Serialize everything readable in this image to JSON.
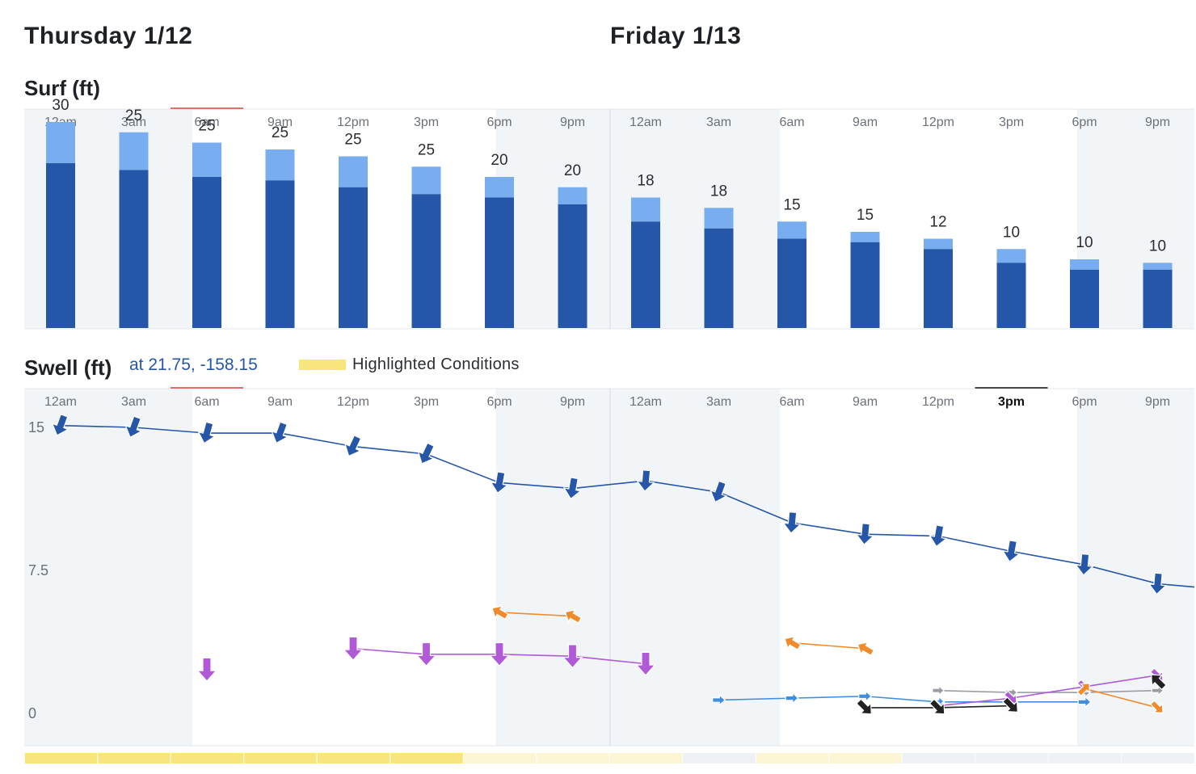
{
  "days": [
    {
      "title": "Thursday 1/12"
    },
    {
      "title": "Friday 1/13"
    }
  ],
  "surf": {
    "title": "Surf (ft)"
  },
  "swell": {
    "title": "Swell (ft)",
    "coords": "at 21.75, -158.15",
    "legend": "Highlighted Conditions"
  },
  "colors": {
    "surf_dark": "#2556a8",
    "surf_light": "#78aef0",
    "night_shade": "#f2f5f8",
    "primary_swell": "#2556a8",
    "orange_swell": "#f08a2b",
    "purple_swell": "#b05ad8",
    "light_blue_swell": "#3f8ee0",
    "gray_swell": "#9a9ea3",
    "black_swell": "#222222",
    "highlight_strong": "#f8e57e",
    "highlight_weak": "#fdf6d4",
    "highlight_none": "#eef1f5"
  },
  "chart_data": [
    {
      "type": "bar",
      "title": "Surf (ft)",
      "categories": [
        "12am",
        "3am",
        "6am",
        "9am",
        "12pm",
        "3pm",
        "6pm",
        "9pm",
        "12am",
        "3am",
        "6am",
        "9am",
        "12pm",
        "3pm",
        "6pm",
        "9pm"
      ],
      "values": [
        30,
        25,
        25,
        25,
        25,
        25,
        20,
        20,
        18,
        18,
        15,
        15,
        12,
        10,
        10,
        10
      ],
      "bar_total_ft": [
        30,
        28.5,
        27,
        26,
        25,
        23.5,
        22,
        20.5,
        19,
        17.5,
        15.5,
        14,
        13,
        11.5,
        10,
        9.5
      ],
      "bar_base_ft": [
        24,
        23,
        22,
        21.5,
        20.5,
        19.5,
        19,
        18,
        15.5,
        14.5,
        13,
        12.5,
        11.5,
        9.5,
        8.5,
        8.5
      ],
      "ylim": [
        0,
        40
      ],
      "highlighted_hour": "6am"
    },
    {
      "type": "line",
      "title": "Swell (ft)",
      "x": [
        "12am",
        "3am",
        "6am",
        "9am",
        "12pm",
        "3pm",
        "6pm",
        "9pm",
        "12am",
        "3am",
        "6am",
        "9am",
        "12pm",
        "3pm",
        "6pm",
        "9pm"
      ],
      "yticks": [
        "15",
        "7.5",
        "0"
      ],
      "ylim": [
        0,
        15.5
      ],
      "selected_hour": "3pm",
      "series": [
        {
          "color": "primary_swell",
          "values": [
            15.1,
            15.0,
            14.7,
            14.7,
            14.0,
            13.6,
            12.1,
            11.8,
            12.2,
            11.6,
            10.0,
            9.4,
            9.3,
            8.5,
            7.8,
            6.8
          ],
          "arrows": [
            200,
            200,
            195,
            200,
            205,
            205,
            190,
            190,
            185,
            200,
            185,
            185,
            190,
            190,
            185,
            185
          ],
          "arrow_size": 1.0
        },
        {
          "color": "orange_swell",
          "values": [
            null,
            null,
            null,
            null,
            null,
            null,
            5.3,
            5.1,
            null,
            null,
            3.7,
            3.4,
            null,
            null,
            null,
            null
          ],
          "arrows": [
            0,
            0,
            0,
            0,
            0,
            0,
            300,
            300,
            0,
            0,
            300,
            300,
            0,
            0,
            0,
            0
          ],
          "arrow_size": 0.8
        },
        {
          "color": "purple_swell",
          "values": [
            null,
            null,
            2.3,
            null,
            3.4,
            3.1,
            3.1,
            3.0,
            2.6,
            null,
            null,
            null,
            null,
            null,
            null,
            null
          ],
          "arrows": [
            0,
            0,
            180,
            0,
            180,
            180,
            180,
            180,
            180,
            0,
            0,
            0,
            0,
            0,
            0,
            0
          ],
          "arrow_size": 1.1
        },
        {
          "color": "light_blue_swell",
          "values": [
            null,
            null,
            null,
            null,
            null,
            null,
            null,
            null,
            null,
            0.7,
            0.8,
            0.9,
            0.6,
            0.6,
            0.6,
            null
          ],
          "arrows": [
            0,
            0,
            0,
            0,
            0,
            0,
            0,
            0,
            0,
            90,
            90,
            90,
            90,
            90,
            90,
            0
          ],
          "arrow_size": 0.6
        },
        {
          "color": "gray_swell",
          "values": [
            null,
            null,
            null,
            null,
            null,
            null,
            null,
            null,
            null,
            null,
            null,
            null,
            1.2,
            1.1,
            1.1,
            1.2
          ],
          "arrows": [
            0,
            0,
            0,
            0,
            0,
            0,
            0,
            0,
            0,
            0,
            0,
            0,
            90,
            90,
            90,
            90
          ],
          "arrow_size": 0.55
        },
        {
          "color": "purple_swell",
          "values": [
            null,
            null,
            null,
            null,
            null,
            null,
            null,
            null,
            null,
            null,
            null,
            null,
            0.4,
            0.8,
            1.4,
            2.0
          ],
          "arrows": [
            0,
            0,
            0,
            0,
            0,
            0,
            0,
            0,
            0,
            0,
            0,
            0,
            135,
            135,
            135,
            135
          ],
          "arrow_size": 0.7
        },
        {
          "color": "black_swell",
          "values": [
            null,
            null,
            null,
            null,
            null,
            null,
            null,
            null,
            null,
            null,
            null,
            0.3,
            0.3,
            0.4,
            null,
            1.7
          ],
          "arrows": [
            0,
            0,
            0,
            0,
            0,
            0,
            0,
            0,
            0,
            0,
            0,
            135,
            135,
            135,
            0,
            315
          ],
          "arrow_size": 0.85
        },
        {
          "color": "orange_swell",
          "values": [
            null,
            null,
            null,
            null,
            null,
            null,
            null,
            null,
            null,
            null,
            null,
            null,
            null,
            null,
            1.3,
            0.3
          ],
          "arrows": [
            0,
            0,
            0,
            0,
            0,
            0,
            0,
            0,
            0,
            0,
            0,
            0,
            0,
            0,
            45,
            135
          ],
          "arrow_size": 0.7
        }
      ]
    }
  ],
  "highlight_bar": [
    "strong",
    "strong",
    "strong",
    "strong",
    "strong",
    "strong",
    "weak",
    "weak",
    "weak",
    "none",
    "weak",
    "weak",
    "none",
    "none",
    "none",
    "none"
  ]
}
